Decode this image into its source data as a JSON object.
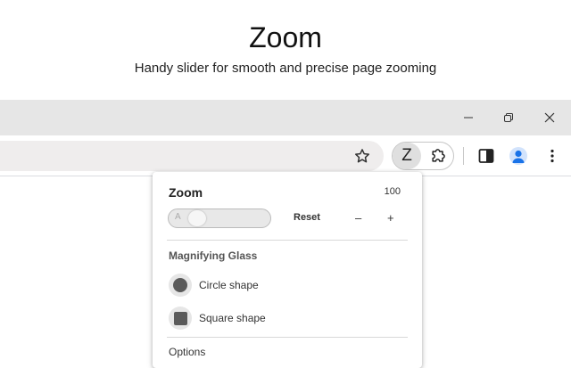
{
  "promo": {
    "title": "Zoom",
    "subtitle": "Handy slider for smooth and precise page zooming"
  },
  "window_controls": {
    "minimize_icon": "minimize-icon",
    "restore_icon": "restore-icon",
    "close_icon": "close-icon"
  },
  "toolbar": {
    "bookmark_icon": "star-icon",
    "zoom_extension_label": "Z",
    "extensions_icon": "puzzle-icon",
    "side_panel_icon": "side-panel-icon",
    "profile_icon": "avatar-icon",
    "menu_icon": "more-vertical-icon"
  },
  "popup": {
    "title": "Zoom",
    "zoom_value": "100",
    "slider_label": "A",
    "reset_label": "Reset",
    "minus_label": "–",
    "plus_label": "+",
    "section_title": "Magnifying Glass",
    "circle_label": "Circle shape",
    "square_label": "Square shape",
    "options_label": "Options"
  },
  "colors": {
    "titlebar": "#e6e6e6",
    "omnibox": "#efeded",
    "active_extension": "#dfdfdf",
    "profile_blue": "#1a73e8"
  }
}
